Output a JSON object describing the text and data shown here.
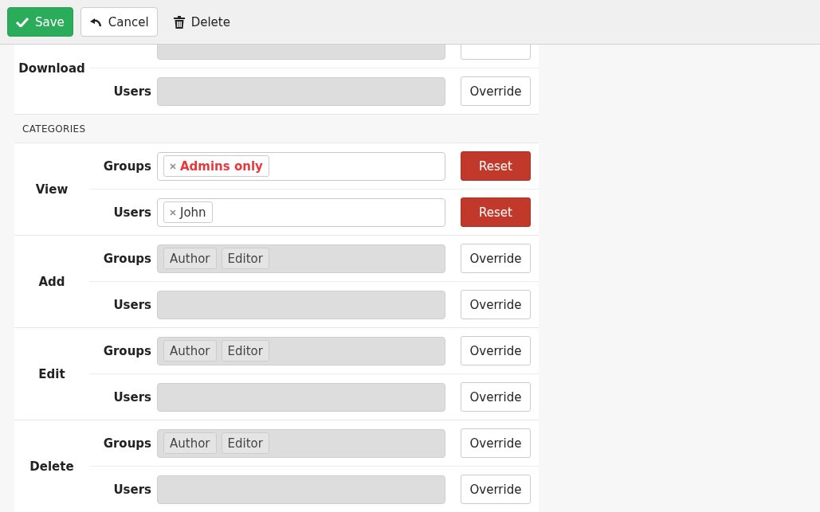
{
  "toolbar": [
    {
      "kind": "save",
      "label": "Save"
    },
    {
      "kind": "cancel",
      "label": "Cancel"
    },
    {
      "kind": "delete",
      "label": "Delete"
    }
  ],
  "sections": [
    {
      "permissions": [
        {
          "name": "Download",
          "rows": [
            {
              "overridden": false,
              "tags": []
            },
            {
              "label": "Users",
              "overridden": false,
              "action": "Override",
              "tags": []
            }
          ]
        }
      ]
    },
    {
      "title": "CATEGORIES",
      "permissions": [
        {
          "name": "View",
          "rows": [
            {
              "label": "Groups",
              "overridden": true,
              "action": "Reset",
              "tags": [
                {
                  "text": "Admins only",
                  "color": "#e8383b"
                }
              ]
            },
            {
              "label": "Users",
              "overridden": true,
              "action": "Reset",
              "tags": [
                {
                  "text": "John",
                  "color": "#333333"
                }
              ]
            }
          ]
        },
        {
          "name": "Add",
          "rows": [
            {
              "label": "Groups",
              "overridden": false,
              "action": "Override",
              "tags": [
                {
                  "text": "Author",
                  "color": "#444444"
                },
                {
                  "text": "Editor",
                  "color": "#444444"
                }
              ]
            },
            {
              "label": "Users",
              "overridden": false,
              "action": "Override",
              "tags": []
            }
          ]
        },
        {
          "name": "Edit",
          "rows": [
            {
              "label": "Groups",
              "overridden": false,
              "action": "Override",
              "tags": [
                {
                  "text": "Author",
                  "color": "#444444"
                },
                {
                  "text": "Editor",
                  "color": "#444444"
                }
              ]
            },
            {
              "label": "Users",
              "overridden": false,
              "action": "Override",
              "tags": []
            }
          ]
        },
        {
          "name": "Delete",
          "rows": [
            {
              "label": "Groups",
              "overridden": false,
              "action": "Override",
              "tags": [
                {
                  "text": "Author",
                  "color": "#444444"
                },
                {
                  "text": "Editor",
                  "color": "#444444"
                }
              ]
            },
            {
              "label": "Users",
              "overridden": false,
              "action": "Override",
              "tags": []
            }
          ]
        }
      ]
    }
  ]
}
